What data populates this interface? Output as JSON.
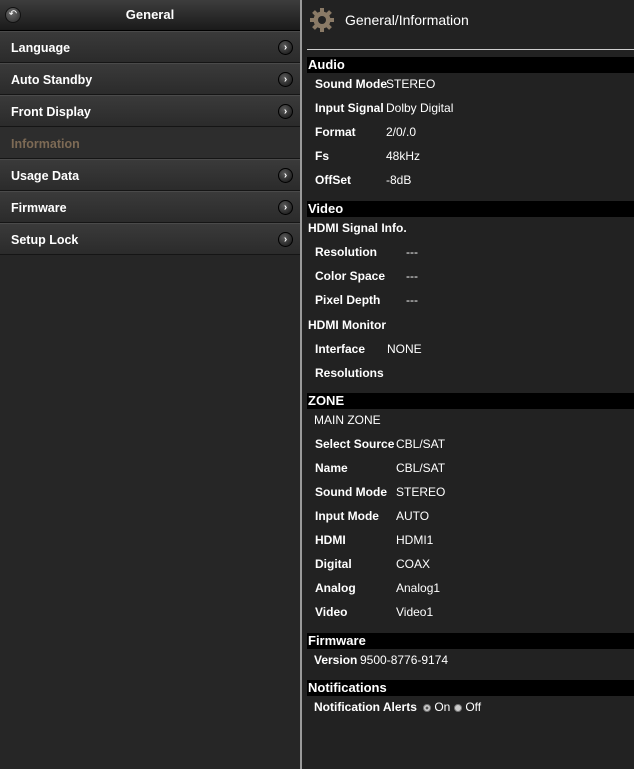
{
  "left": {
    "title": "General",
    "menu": [
      {
        "label": "Language"
      },
      {
        "label": "Auto Standby"
      },
      {
        "label": "Front Display"
      },
      {
        "label": "Information"
      },
      {
        "label": "Usage Data"
      },
      {
        "label": "Firmware"
      },
      {
        "label": "Setup Lock"
      }
    ]
  },
  "right": {
    "title": "General/Information",
    "audio": {
      "heading": "Audio",
      "rows": [
        {
          "k": "Sound Mode",
          "v": "STEREO"
        },
        {
          "k": "Input Signal",
          "v": "Dolby Digital"
        },
        {
          "k": "Format",
          "v": "2/0/.0"
        },
        {
          "k": "Fs",
          "v": "48kHz"
        },
        {
          "k": "OffSet",
          "v": "-8dB"
        }
      ]
    },
    "video": {
      "heading": "Video",
      "hdmi_signal_title": "HDMI Signal Info.",
      "signal_rows": [
        {
          "k": "Resolution",
          "v": "---"
        },
        {
          "k": "Color Space",
          "v": "---"
        },
        {
          "k": "Pixel Depth",
          "v": "---"
        }
      ],
      "hdmi_monitor_title": "HDMI Monitor",
      "monitor_rows": [
        {
          "k": "Interface",
          "v": "NONE"
        },
        {
          "k": "Resolutions",
          "v": ""
        }
      ]
    },
    "zone": {
      "heading": "ZONE",
      "main_zone_title": "MAIN ZONE",
      "rows": [
        {
          "k": "Select Source",
          "v": "CBL/SAT"
        },
        {
          "k": "Name",
          "v": "CBL/SAT"
        },
        {
          "k": "Sound Mode",
          "v": "STEREO"
        },
        {
          "k": "Input Mode",
          "v": "AUTO"
        },
        {
          "k": "HDMI",
          "v": "HDMI1"
        },
        {
          "k": "Digital",
          "v": "COAX"
        },
        {
          "k": "Analog",
          "v": "Analog1"
        },
        {
          "k": "Video",
          "v": "Video1"
        }
      ]
    },
    "firmware": {
      "heading": "Firmware",
      "version_label": "Version",
      "version_value": "9500-8776-9174"
    },
    "notifications": {
      "heading": "Notifications",
      "label": "Notification Alerts",
      "on_label": "On",
      "off_label": "Off",
      "selected": "On"
    }
  }
}
